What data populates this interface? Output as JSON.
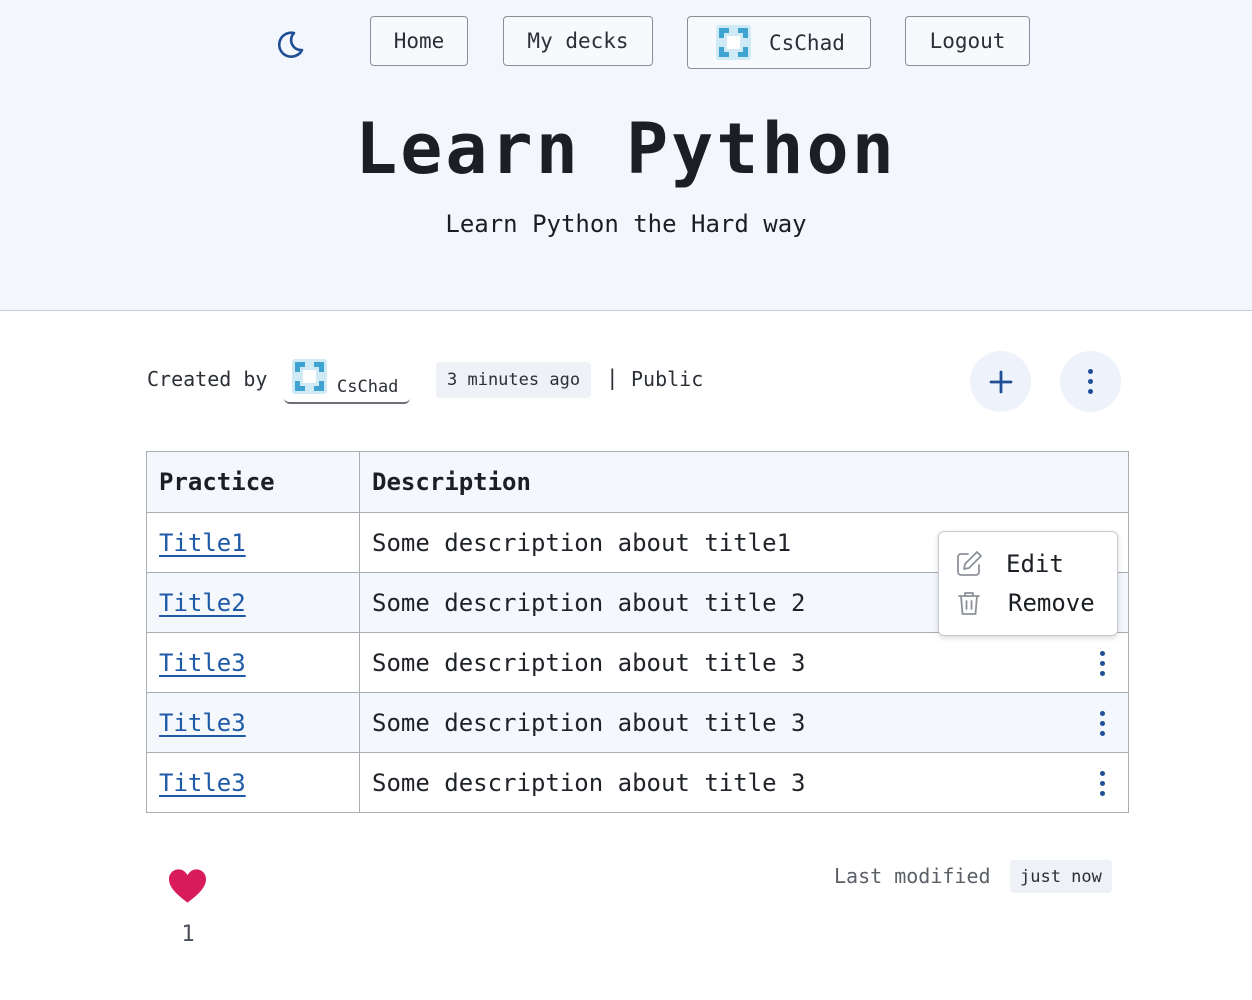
{
  "nav": {
    "theme_icon": "moon-icon",
    "home_label": "Home",
    "decks_label": "My decks",
    "user_label": "CsChad",
    "logout_label": "Logout"
  },
  "deck": {
    "title": "Learn Python",
    "subtitle": "Learn Python the Hard way"
  },
  "meta": {
    "created_by_label": "Created by",
    "author": "CsChad",
    "created_time": "3 minutes ago",
    "separator": "|",
    "visibility": "Public",
    "add_icon": "plus-icon",
    "more_icon": "more-vertical-icon"
  },
  "table": {
    "headers": [
      "Practice",
      "Description"
    ],
    "rows": [
      {
        "title": "Title1",
        "description": "Some description about title1"
      },
      {
        "title": "Title2",
        "description": "Some description about title 2"
      },
      {
        "title": "Title3",
        "description": "Some description about title 3"
      },
      {
        "title": "Title3",
        "description": "Some description about title 3"
      },
      {
        "title": "Title3",
        "description": "Some description about title 3"
      }
    ]
  },
  "row_menu": {
    "edit_label": "Edit",
    "remove_label": "Remove",
    "edit_icon": "edit-icon",
    "remove_icon": "trash-icon"
  },
  "footer": {
    "likes_count": "1",
    "heart_icon": "heart-icon",
    "last_modified_label": "Last modified",
    "last_modified_value": "just now"
  },
  "colors": {
    "header_bg": "#f3f6fc",
    "link": "#1f5aa8",
    "accent": "#1f4e96",
    "heart": "#d81b5a"
  }
}
